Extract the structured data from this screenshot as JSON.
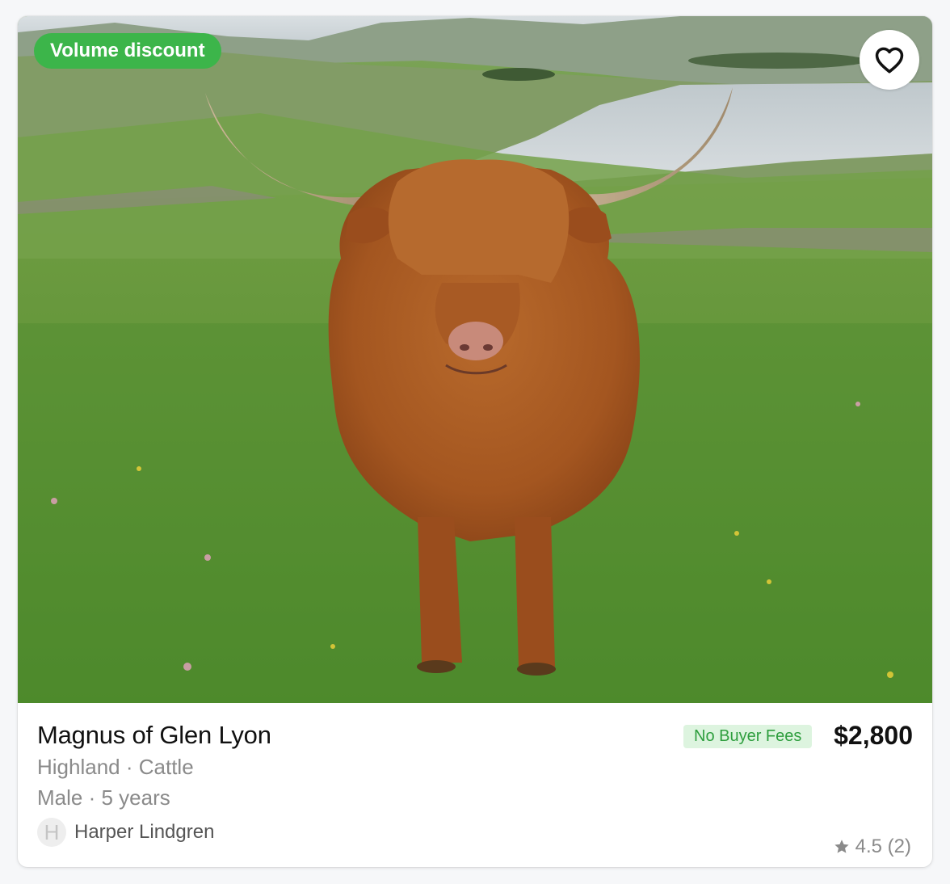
{
  "listing": {
    "discount_badge": "Volume discount",
    "title": "Magnus of Glen Lyon",
    "breed_line": "Highland · Cattle",
    "sex_age_line": "Male · 5 years",
    "fees_badge": "No Buyer Fees",
    "price": "$2,800",
    "favorite_icon": "heart-outline-icon",
    "photo_subject": "highland-cow-photo"
  },
  "seller": {
    "avatar_initial": "H",
    "name": "Harper Lindgren"
  },
  "rating": {
    "icon": "star-icon",
    "text": "4.5 (2)",
    "score": 4.5,
    "count": 2
  },
  "colors": {
    "discount_badge_bg": "#3cb54a",
    "fees_badge_bg": "#ddf4df",
    "fees_badge_text": "#2e9e3e"
  }
}
